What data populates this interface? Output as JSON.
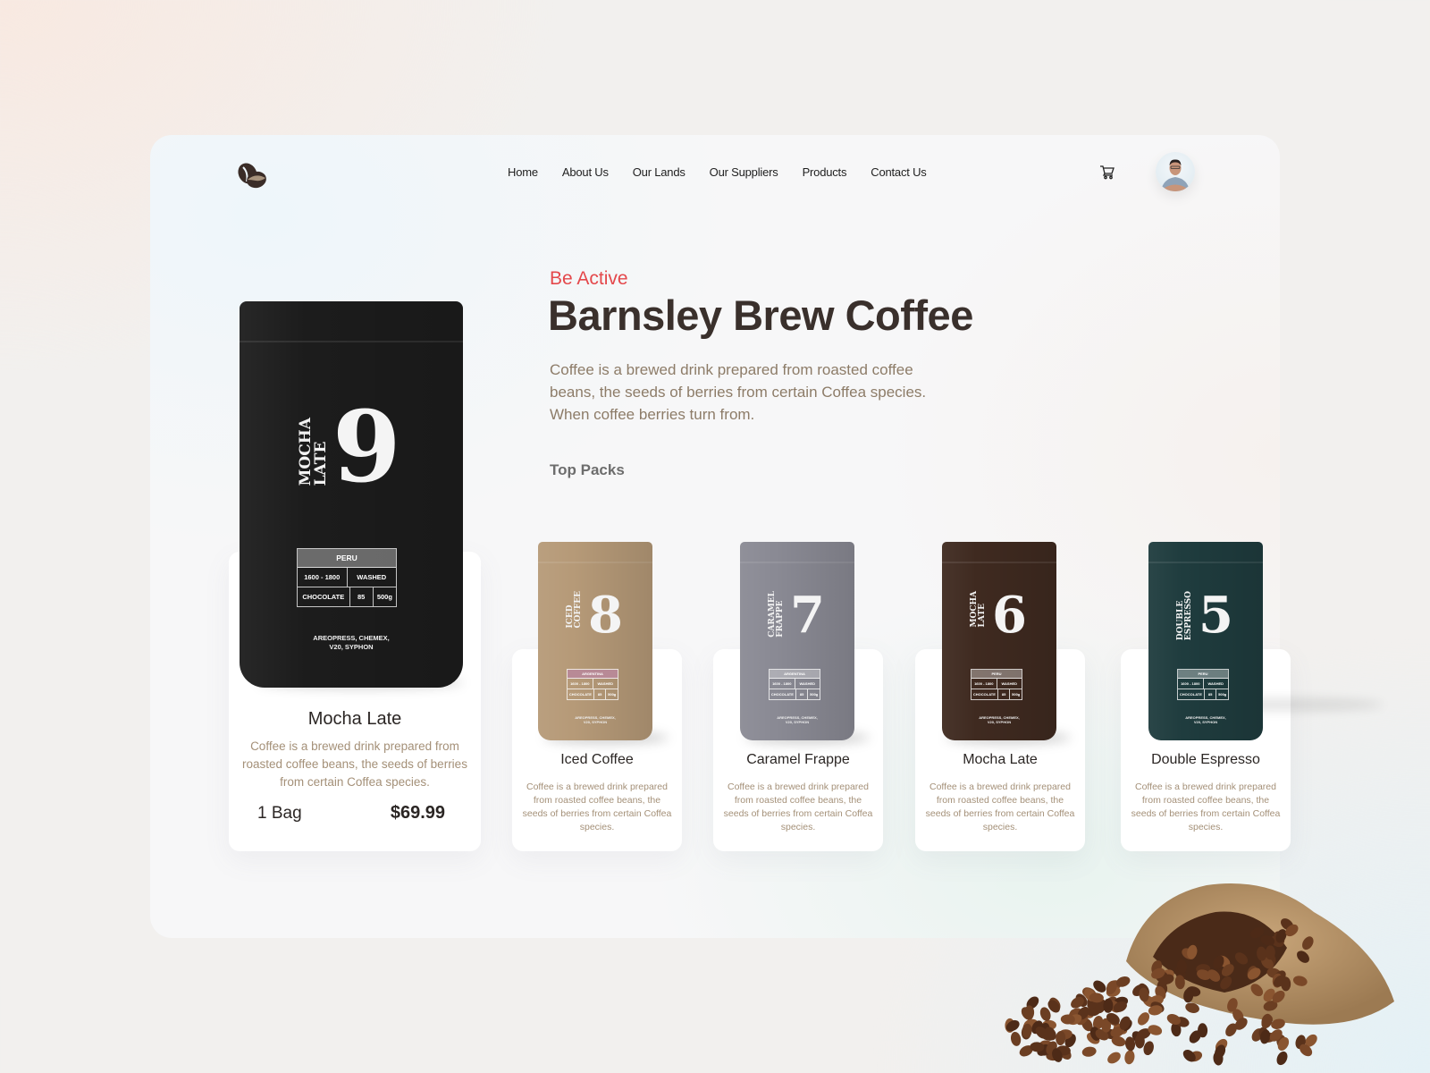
{
  "brand": {
    "logo_icon": "coffee-beans-icon"
  },
  "nav": {
    "items": [
      "Home",
      "About Us",
      "Our Lands",
      "Our Suppliers",
      "Products",
      "Contact Us"
    ],
    "cart_icon": "cart-icon",
    "avatar_icon": "user-avatar"
  },
  "hero": {
    "eyebrow": "Be Active",
    "title": "Barnsley Brew Coffee",
    "description": "Coffee is a brewed drink prepared from roasted coffee beans, the seeds of berries from certain Coffea species. When coffee berries turn from.",
    "section_title": "Top Packs"
  },
  "featured": {
    "name": "Mocha Late",
    "description": "Coffee is a brewed drink prepared from roasted coffee beans, the seeds of berries from certain Coffea species.",
    "quantity": "1 Bag",
    "price": "$69.99",
    "bag": {
      "number": "9",
      "label_line1": "MOCHA",
      "label_line2": "LATE",
      "color": "#1c1c1c",
      "origin": "PERU",
      "altitude": "1600 - 1800",
      "process": "WASHED",
      "notes": "CHOCOLATE",
      "score": "85",
      "weight": "500g",
      "methods_line1": "AREOPRESS, CHEMEX,",
      "methods_line2": "V20, SYPHON",
      "header_color": "rgba(255,255,255,0.35)"
    }
  },
  "packs": [
    {
      "name": "Iced Coffee",
      "description": "Coffee is a brewed drink prepared from roasted coffee beans, the seeds of berries from certain Coffea species.",
      "bag": {
        "number": "8",
        "label_line1": "ICED",
        "label_line2": "COFFEE",
        "color": "#b69a78",
        "origin": "ARGENTINA",
        "header_color": "#b88a96",
        "altitude": "1600 - 1800",
        "process": "WASHED",
        "notes": "CHOCOLATE",
        "score": "85",
        "weight": "500g",
        "methods_line1": "AREOPRESS, CHEMEX,",
        "methods_line2": "V20, SYPHON"
      }
    },
    {
      "name": "Caramel Frappe",
      "description": "Coffee is a brewed drink prepared from roasted coffee beans, the seeds of berries from certain Coffea species.",
      "bag": {
        "number": "7",
        "label_line1": "CARAMEL",
        "label_line2": "FRAPPE",
        "color": "#8a8a94",
        "origin": "ARGENTINA",
        "header_color": "rgba(255,255,255,0.3)",
        "altitude": "1600 - 1800",
        "process": "WASHED",
        "notes": "CHOCOLATE",
        "score": "85",
        "weight": "500g",
        "methods_line1": "AREOPRESS, CHEMEX,",
        "methods_line2": "V20, SYPHON"
      }
    },
    {
      "name": "Mocha Late",
      "description": "Coffee is a brewed drink prepared from roasted coffee beans, the seeds of berries from certain Coffea species.",
      "bag": {
        "number": "6",
        "label_line1": "MOCHA",
        "label_line2": "LATE",
        "color": "#3f2a20",
        "origin": "PERU",
        "header_color": "rgba(255,255,255,0.35)",
        "altitude": "1600 - 1800",
        "process": "WASHED",
        "notes": "CHOCOLATE",
        "score": "85",
        "weight": "500g",
        "methods_line1": "AREOPRESS, CHEMEX,",
        "methods_line2": "V20, SYPHON"
      }
    },
    {
      "name": "Double Espresso",
      "description": "Coffee is a brewed drink prepared from roasted coffee beans, the seeds of berries from certain Coffea species.",
      "bag": {
        "number": "5",
        "label_line1": "DOUBLE",
        "label_line2": "ESPRESSO",
        "color": "#1f3c3e",
        "origin": "PERU",
        "header_color": "rgba(255,255,255,0.35)",
        "altitude": "1600 - 1800",
        "process": "WASHED",
        "notes": "CHOCOLATE",
        "score": "85",
        "weight": "500g",
        "methods_line1": "AREOPRESS, CHEMEX,",
        "methods_line2": "V20, SYPHON"
      }
    }
  ],
  "decor": {
    "sack_image": "coffee-sack-with-beans"
  },
  "colors": {
    "accent": "#e4484b",
    "heading": "#3a302c",
    "body_text": "#8d7c68",
    "card_text": "#a49078"
  }
}
